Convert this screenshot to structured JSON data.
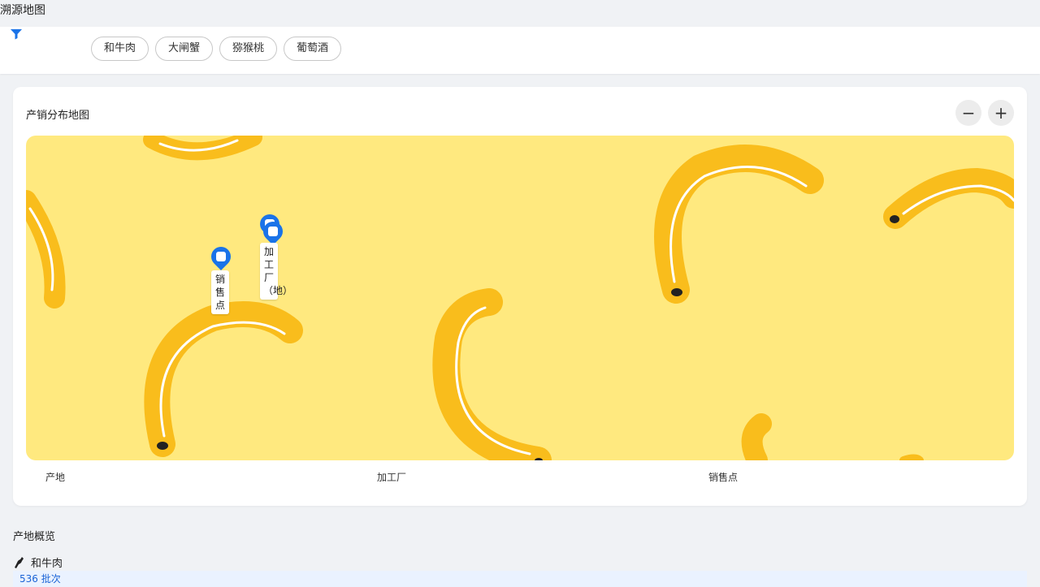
{
  "page": {
    "title": "溯源地图"
  },
  "filters": {
    "icon": "filter-icon",
    "chips": [
      "和牛肉",
      "大闸蟹",
      "猕猴桃",
      "葡萄酒"
    ]
  },
  "map_card": {
    "title": "产销分布地图",
    "zoom_out": "−",
    "zoom_in": "+",
    "markers": [
      {
        "type": "sale-point",
        "label": "销售点"
      },
      {
        "type": "factory",
        "label": "加工厂（地）"
      }
    ],
    "legend": [
      "产地",
      "加工厂",
      "销售点"
    ]
  },
  "overview": {
    "title": "产地概览",
    "origin": {
      "icon": "cow-icon",
      "name": "和牛肉"
    },
    "batch": "536 批次"
  },
  "colors": {
    "accent": "#1a73e8",
    "map_bg": "#ffe97f",
    "banana": "#f9bd1c"
  }
}
